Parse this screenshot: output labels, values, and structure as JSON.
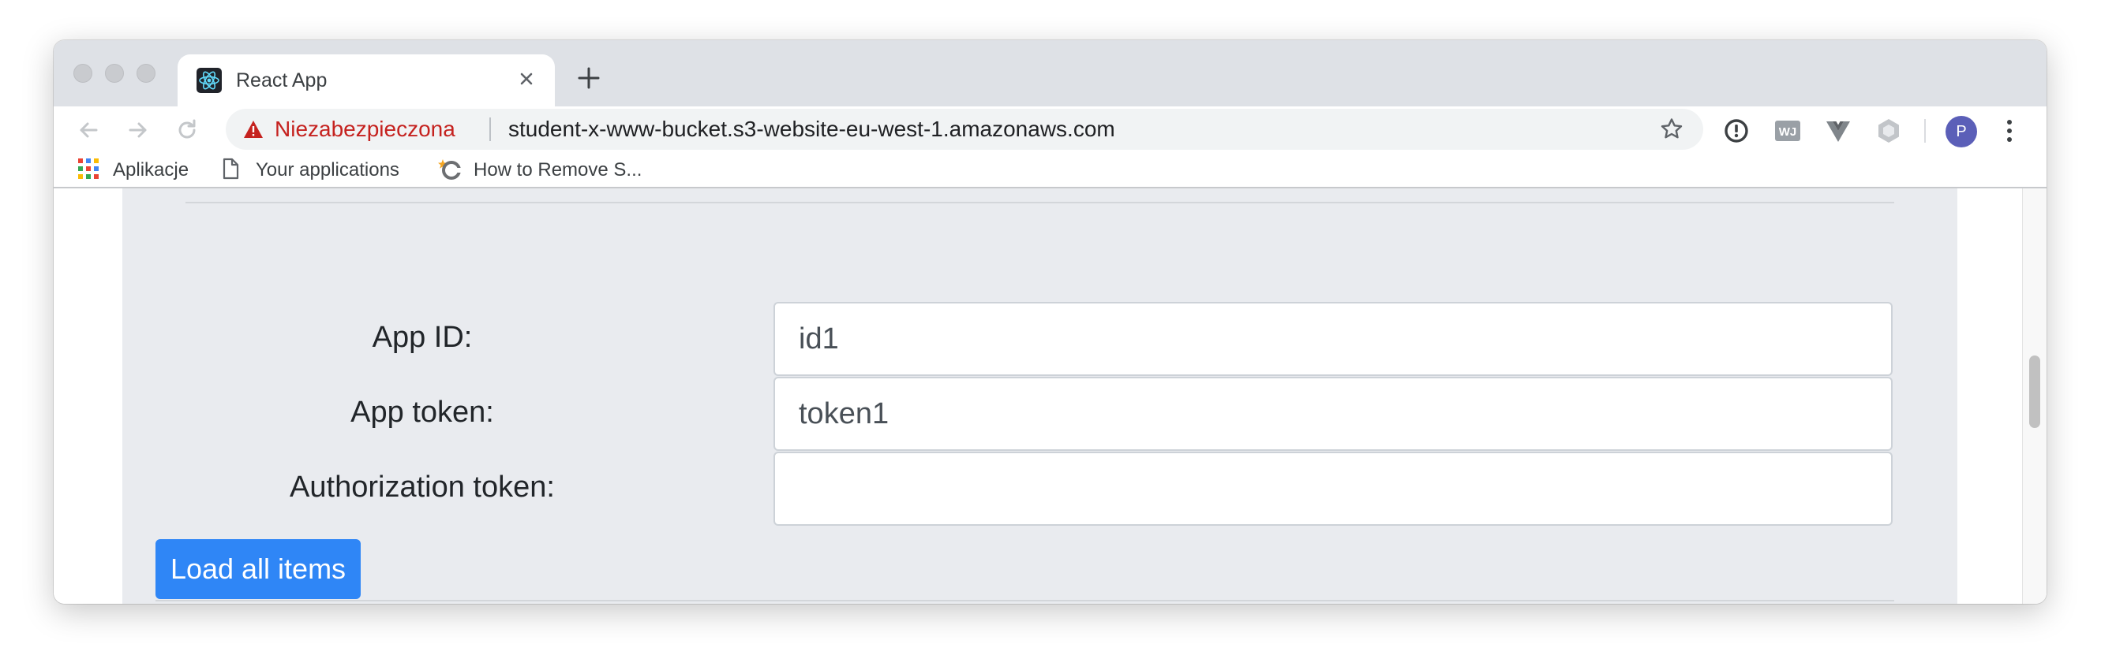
{
  "browser": {
    "tab": {
      "title": "React App",
      "favicon": "react-icon"
    },
    "address": {
      "security_label": "Niezabezpieczona",
      "url": "student-x-www-bucket.s3-website-eu-west-1.amazonaws.com"
    },
    "avatar_initial": "P",
    "bookmarks": [
      {
        "label": "Aplikacje",
        "icon": "apps-grid-icon"
      },
      {
        "label": "Your applications",
        "icon": "page-icon"
      },
      {
        "label": "How to Remove S...",
        "icon": "site-favicon-icon"
      }
    ],
    "extensions": [
      "password-manager-icon",
      "wj-extension-icon",
      "vue-devtools-icon",
      "hexagon-extension-icon"
    ],
    "colors": {
      "insecure": "#c5221f",
      "avatar": "#5b5fb8"
    }
  },
  "form": {
    "app_id_label": "App ID:",
    "app_id_value": "id1",
    "app_token_label": "App token:",
    "app_token_value": "token1",
    "auth_token_label": "Authorization token:",
    "auth_token_value": "",
    "load_button": "Load all items",
    "colors": {
      "button": "#2f86f6",
      "panel": "#e9ebef"
    }
  }
}
